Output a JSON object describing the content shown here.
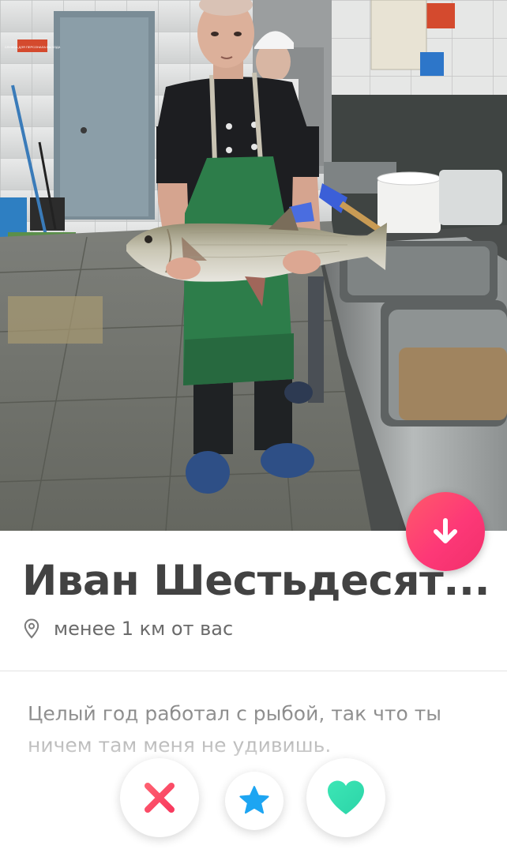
{
  "profile": {
    "name": "Иван Шестьдесят...",
    "distance": "менее 1 км от вас",
    "bio": "Целый год работал с рыбой, так что ты ничем там меня не удивишь."
  },
  "photo": {
    "sign_text": "СЛУЖБА ДЛЯ ПЕРСОНАЛА ВЫХОДА"
  },
  "icons": {
    "info": "arrow-down-icon",
    "location": "location-pin-icon",
    "nope": "x-icon",
    "super_like": "star-icon",
    "like": "heart-icon"
  },
  "colors": {
    "info_button": "#fd3877",
    "nope": "#fd4d5d",
    "super_like": "#1da5f2",
    "like": "#3fe0b0",
    "name_text": "#424242",
    "bio_text": "#8a8a8a"
  }
}
